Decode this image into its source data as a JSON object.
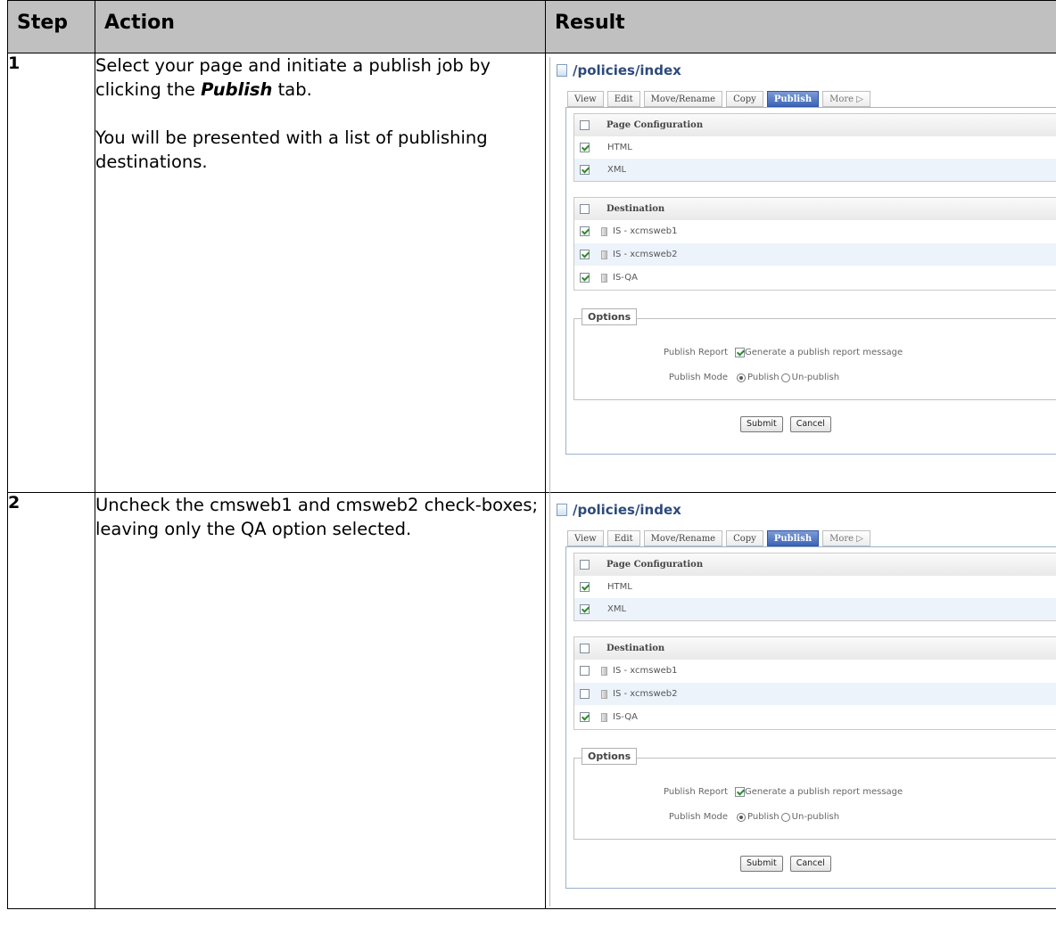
{
  "table": {
    "headers": {
      "step": "Step",
      "action": "Action",
      "result": "Result"
    },
    "rows": [
      {
        "step": "1",
        "action_line1_pre": "Select your page and initiate a publish job by clicking the ",
        "action_line1_em": "Publish",
        "action_line1_post": " tab.",
        "action_p2": "You will be presented with a list of publishing destinations."
      },
      {
        "step": "2",
        "action_p1": "Uncheck the cmsweb1 and cmsweb2 check-boxes; leaving only the QA option selected."
      }
    ]
  },
  "screens": [
    {
      "path": "/policies/index",
      "tabs": [
        "View",
        "Edit",
        "Move/Rename",
        "Copy",
        "Publish",
        "More"
      ],
      "active_tab": "Publish",
      "page_config_header": "Page Configuration",
      "page_configs": [
        {
          "label": "HTML",
          "checked": true
        },
        {
          "label": "XML",
          "checked": true
        }
      ],
      "destination_header": "Destination",
      "destinations": [
        {
          "label": "IS - xcmsweb1",
          "checked": true
        },
        {
          "label": "IS - xcmsweb2",
          "checked": true
        },
        {
          "label": "IS-QA",
          "checked": true
        }
      ],
      "options_legend": "Options",
      "publish_report_label": "Publish Report",
      "publish_report_text": "Generate a publish report message",
      "publish_mode_label": "Publish Mode",
      "mode_publish": "Publish",
      "mode_unpublish": "Un-publish",
      "submit": "Submit",
      "cancel": "Cancel"
    },
    {
      "path": "/policies/index",
      "tabs": [
        "View",
        "Edit",
        "Move/Rename",
        "Copy",
        "Publish",
        "More"
      ],
      "active_tab": "Publish",
      "page_config_header": "Page Configuration",
      "page_configs": [
        {
          "label": "HTML",
          "checked": true
        },
        {
          "label": "XML",
          "checked": true
        }
      ],
      "destination_header": "Destination",
      "destinations": [
        {
          "label": "IS - xcmsweb1",
          "checked": false
        },
        {
          "label": "IS - xcmsweb2",
          "checked": false
        },
        {
          "label": "IS-QA",
          "checked": true
        }
      ],
      "options_legend": "Options",
      "publish_report_label": "Publish Report",
      "publish_report_text": "Generate a publish report message",
      "publish_mode_label": "Publish Mode",
      "mode_publish": "Publish",
      "mode_unpublish": "Un-publish",
      "submit": "Submit",
      "cancel": "Cancel"
    }
  ]
}
